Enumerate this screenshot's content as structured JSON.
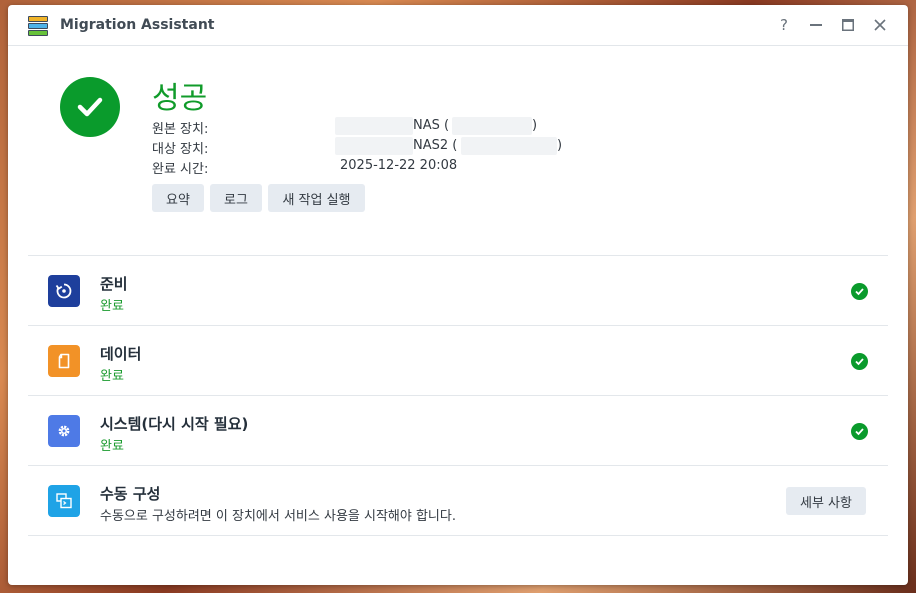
{
  "window": {
    "title": "Migration Assistant",
    "help_glyph": "?",
    "close_glyph": "✕"
  },
  "result": {
    "title": "성공",
    "source_label": "원본 장치:",
    "source_value": "NAS (",
    "source_close": ")",
    "target_label": "대상 장치:",
    "target_value": "NAS2 (",
    "target_close": ")",
    "time_label": "완료 시간:",
    "time_value": "2025-12-22 20:08",
    "buttons": {
      "summary": "요약",
      "log": "로그",
      "new_task": "새 작업 실행"
    }
  },
  "tasks": [
    {
      "title": "준비",
      "status": "완료",
      "icon": "restart-icon",
      "color": "#1e3f9c"
    },
    {
      "title": "데이터",
      "status": "완료",
      "icon": "file-icon",
      "color": "#f29227"
    },
    {
      "title": "시스템(다시 시작 필요)",
      "status": "완료",
      "icon": "gear-icon",
      "color": "#4e7ae6"
    },
    {
      "title": "수동 구성",
      "description": "수동으로 구성하려면 이 장치에서 서비스 사용을 시작해야 합니다.",
      "icon": "manual-config-icon",
      "color": "#1fa3e6",
      "button": "세부 사항"
    }
  ],
  "colors": {
    "success": "#0a9b2c",
    "status_text": "#1a9b2e"
  }
}
